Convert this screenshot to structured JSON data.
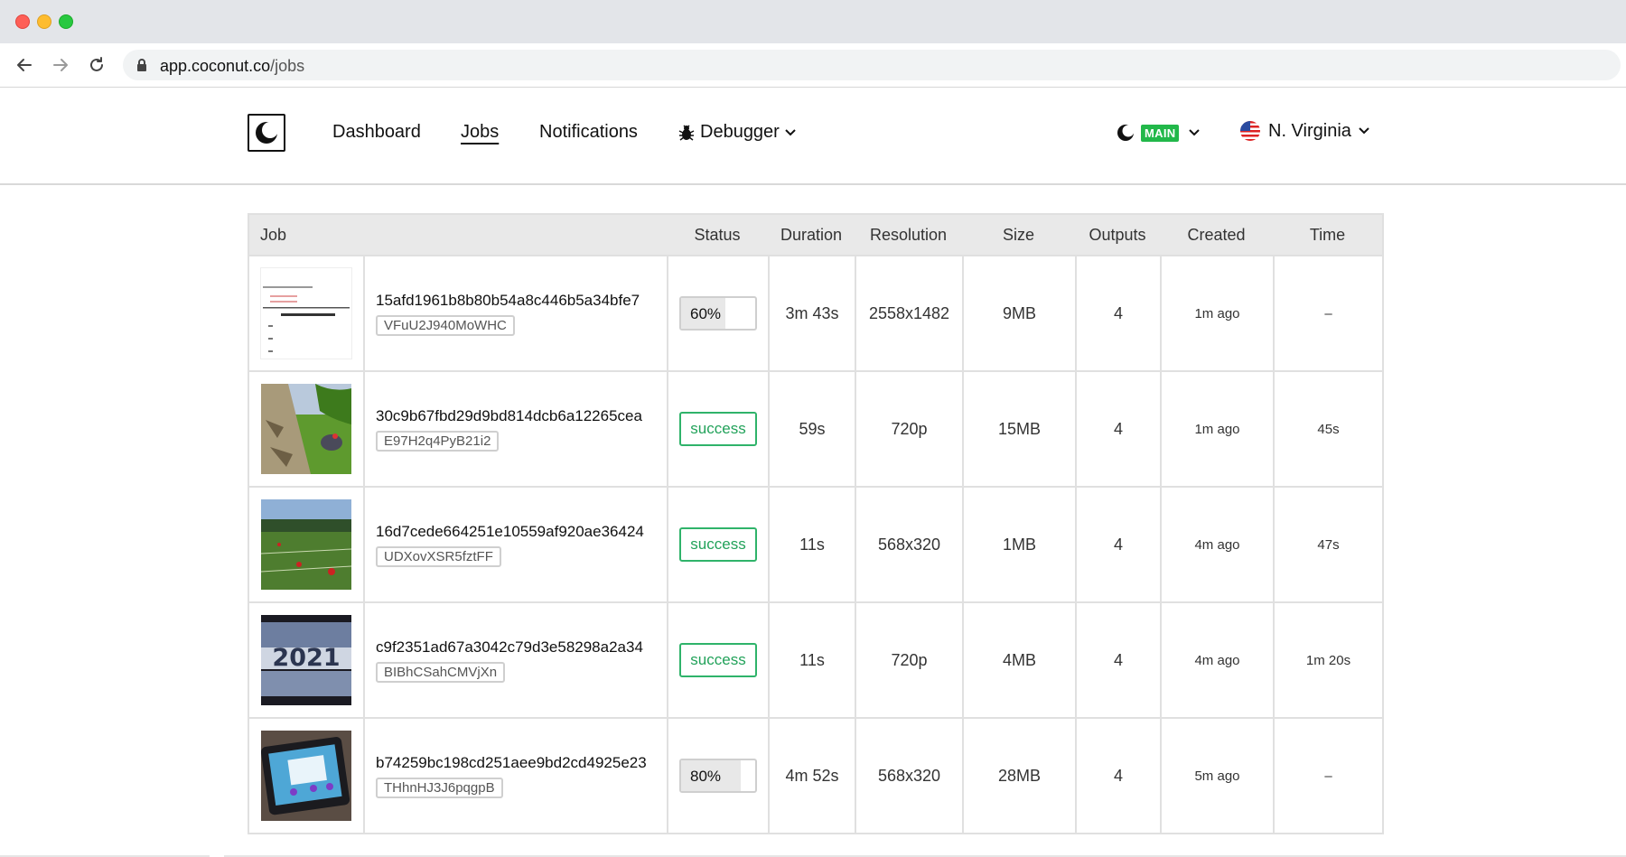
{
  "browser": {
    "url_host": "app.coconut.co",
    "url_path": "/jobs"
  },
  "nav": {
    "dashboard": "Dashboard",
    "jobs": "Jobs",
    "notifications": "Notifications",
    "debugger": "Debugger"
  },
  "environment": {
    "badge": "MAIN",
    "badge_color": "#22b84a"
  },
  "region": {
    "label": "N. Virginia"
  },
  "table": {
    "headers": {
      "job": "Job",
      "status": "Status",
      "duration": "Duration",
      "resolution": "Resolution",
      "size": "Size",
      "outputs": "Outputs",
      "created": "Created",
      "time": "Time"
    },
    "rows": [
      {
        "job_id": "15afd1961b8b80b54a8c446b5a34bfe7",
        "tag": "VFuU2J940MoWHC",
        "status": "60%",
        "progress": 0.6,
        "duration": "3m 43s",
        "resolution": "2558x1482",
        "size": "9MB",
        "outputs": "4",
        "created": "1m ago",
        "time": "–",
        "thumbnail": "math-worksheet"
      },
      {
        "job_id": "30c9b67fbd29d9bd814dcb6a12265cea",
        "tag": "E97H2q4PyB21i2",
        "status": "success",
        "duration": "59s",
        "resolution": "720p",
        "size": "15MB",
        "outputs": "4",
        "created": "1m ago",
        "time": "45s",
        "thumbnail": "animated-field"
      },
      {
        "job_id": "16d7cede664251e10559af920ae36424",
        "tag": "UDXovXSR5fztFF",
        "status": "success",
        "duration": "11s",
        "resolution": "568x320",
        "size": "1MB",
        "outputs": "4",
        "created": "4m ago",
        "time": "47s",
        "thumbnail": "sports-field"
      },
      {
        "job_id": "c9f2351ad67a3042c79d3e58298a2a34",
        "tag": "BIBhCSahCMVjXn",
        "status": "success",
        "duration": "11s",
        "resolution": "720p",
        "size": "4MB",
        "outputs": "4",
        "created": "4m ago",
        "time": "1m 20s",
        "thumbnail": "year-2021-collage",
        "thumbnail_text": "2021"
      },
      {
        "job_id": "b74259bc198cd251aee9bd2cd4925e23",
        "tag": "THhnHJ3J6pqgpB",
        "status": "80%",
        "progress": 0.8,
        "duration": "4m 52s",
        "resolution": "568x320",
        "size": "28MB",
        "outputs": "4",
        "created": "5m ago",
        "time": "–",
        "thumbnail": "tablet-screen"
      }
    ]
  },
  "colors": {
    "success_border": "#2fb36a",
    "success_text": "#22a25a"
  }
}
